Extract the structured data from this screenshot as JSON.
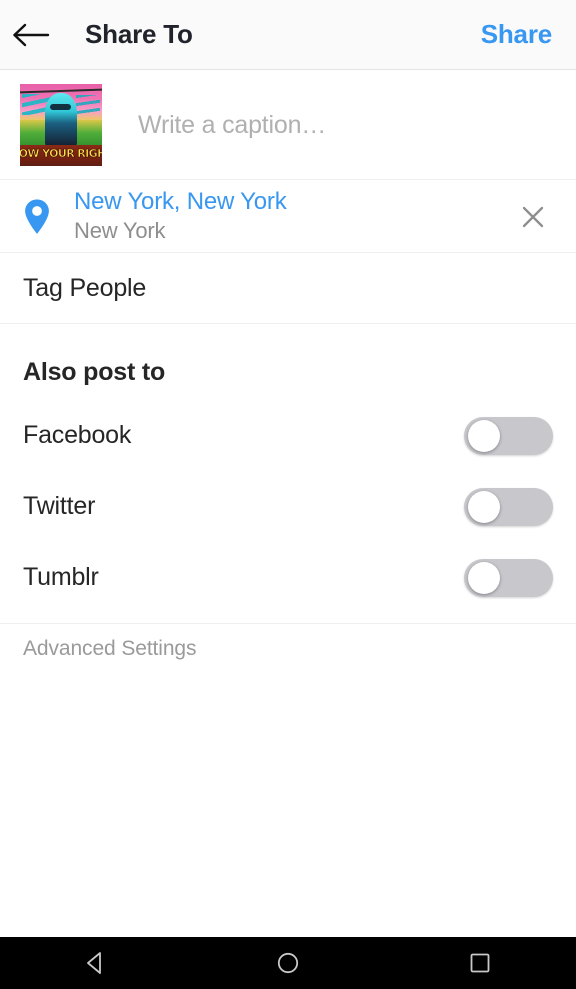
{
  "header": {
    "title": "Share To",
    "share_label": "Share",
    "back_icon": "back-arrow-icon"
  },
  "caption": {
    "placeholder": "Write a caption…",
    "value": "",
    "thumbnail_alt": "graffiti mural photo",
    "thumbnail_text": "KNOW YOUR RIGHTS"
  },
  "location": {
    "pin_icon": "location-pin-icon",
    "primary": "New York, New York",
    "secondary": "New York",
    "clear_icon": "close-icon",
    "accent_color": "#3897f0"
  },
  "tag_people": {
    "label": "Tag People"
  },
  "also_post_to": {
    "title": "Also post to",
    "services": [
      {
        "name": "Facebook",
        "enabled": false
      },
      {
        "name": "Twitter",
        "enabled": false
      },
      {
        "name": "Tumblr",
        "enabled": false
      }
    ]
  },
  "advanced": {
    "label": "Advanced Settings"
  },
  "navbar": {
    "back_icon": "nav-back-triangle-icon",
    "home_icon": "nav-home-circle-icon",
    "recents_icon": "nav-recents-square-icon"
  }
}
